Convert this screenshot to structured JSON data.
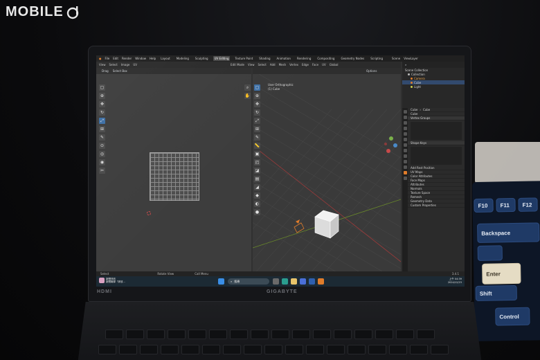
{
  "watermark": {
    "text": "MOBILE"
  },
  "laptop": {
    "bezel_left": "HDMI",
    "bezel_brand": "GIGABYTE"
  },
  "blender": {
    "app_title": "Blender",
    "menu": [
      "File",
      "Edit",
      "Render",
      "Window",
      "Help"
    ],
    "workspaces": [
      "Layout",
      "Modeling",
      "Sculpting",
      "UV Editing",
      "Texture Paint",
      "Shading",
      "Animation",
      "Rendering",
      "Compositing",
      "Geometry Nodes",
      "Scripting"
    ],
    "active_workspace": "UV Editing",
    "scene_field": "Scene",
    "view_layer_field": "ViewLayer",
    "uv_editor": {
      "header_items": [
        "View",
        "Select",
        "Image",
        "UV"
      ],
      "tool_settings": [
        "Drag",
        "Select Box"
      ]
    },
    "viewport": {
      "mode": "Edit Mode",
      "header_items": [
        "View",
        "Select",
        "Add",
        "Mesh",
        "Vertex",
        "Edge",
        "Face",
        "UV"
      ],
      "orientation": "Global",
      "options": "Options",
      "info_line1": "User Orthographic",
      "info_line2": "(1) Cube"
    },
    "outliner": {
      "title": "Scene Collection",
      "rows": [
        "Collection",
        "Camera",
        "Cube",
        "Light"
      ],
      "selected": "Cube"
    },
    "properties": {
      "breadcrumb": [
        "Cube",
        "Cube"
      ],
      "mesh_name": "Cube",
      "panels": [
        "Vertex Groups",
        "Shape Keys",
        "Add Rest Position",
        "UV Maps",
        "Color Attributes",
        "Face Maps",
        "Attributes",
        "Normals",
        "Texture Space",
        "Remesh",
        "Geometry Data",
        "Custom Properties"
      ]
    },
    "status": {
      "left": "Select",
      "middle": "Rotate View",
      "right": "Call Menu",
      "version": "3.4.1"
    }
  },
  "taskbar": {
    "news_line1": "新聞快訊",
    "news_line2": "新聞報導「奔放...",
    "search_placeholder": "搜尋",
    "time": "上午 04:39",
    "date": "2024/12/23"
  },
  "keyboard": {
    "keys": [
      "F10",
      "F11",
      "F12",
      "Backspace",
      "Enter",
      "Shift",
      "Control"
    ]
  },
  "colors": {
    "blender_bg": "#303030",
    "accent_blue": "#3d6fa5",
    "selection_orange": "#e07c2a",
    "keyboard_blue": "#1f3a66"
  }
}
